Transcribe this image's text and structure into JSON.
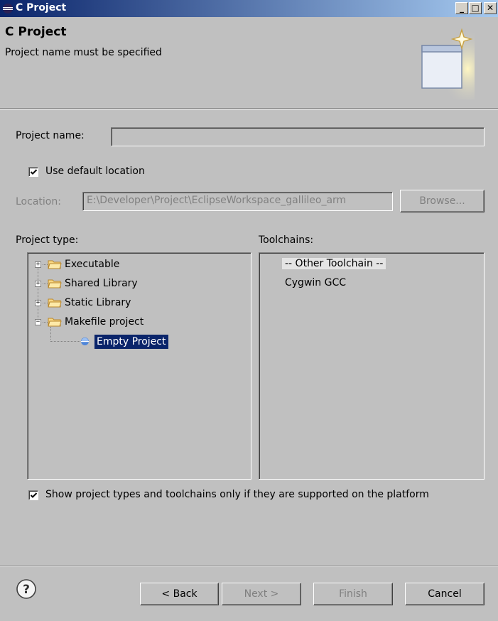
{
  "window": {
    "title": "C Project",
    "min_label": "_",
    "max_label": "□",
    "close_label": "✕"
  },
  "header": {
    "title": "C Project",
    "message": "Project name must be specified"
  },
  "form": {
    "project_name_label": "Project name:",
    "project_name_value": "",
    "use_default_location_label": "Use default location",
    "use_default_location_checked": true,
    "location_label": "Location:",
    "location_value": "E:\\Developer\\Project\\EclipseWorkspace_gallileo_arm",
    "browse_label": "Browse..."
  },
  "project_type": {
    "label": "Project type:",
    "items": [
      {
        "label": "Executable",
        "expanded": false
      },
      {
        "label": "Shared Library",
        "expanded": false
      },
      {
        "label": "Static Library",
        "expanded": false
      },
      {
        "label": "Makefile project",
        "expanded": true
      },
      {
        "label": "Empty Project",
        "selected": true
      }
    ]
  },
  "toolchains": {
    "label": "Toolchains:",
    "items": [
      "-- Other Toolchain --",
      "Cygwin GCC"
    ]
  },
  "filter": {
    "label": "Show project types and toolchains only if they are supported on the platform",
    "checked": true
  },
  "buttons": {
    "back": "< Back",
    "next": "Next >",
    "finish": "Finish",
    "cancel": "Cancel"
  },
  "icons": {
    "title": "eclipse-icon",
    "help": "help-icon",
    "folder": "folder-icon",
    "project": "project-bullet-icon",
    "banner": "new-project-wizard-icon"
  },
  "colors": {
    "titlebar_start": "#0a246a",
    "titlebar_end": "#a6caf0",
    "selection": "#0a246a",
    "dialog_bg": "#c0c0c0"
  }
}
